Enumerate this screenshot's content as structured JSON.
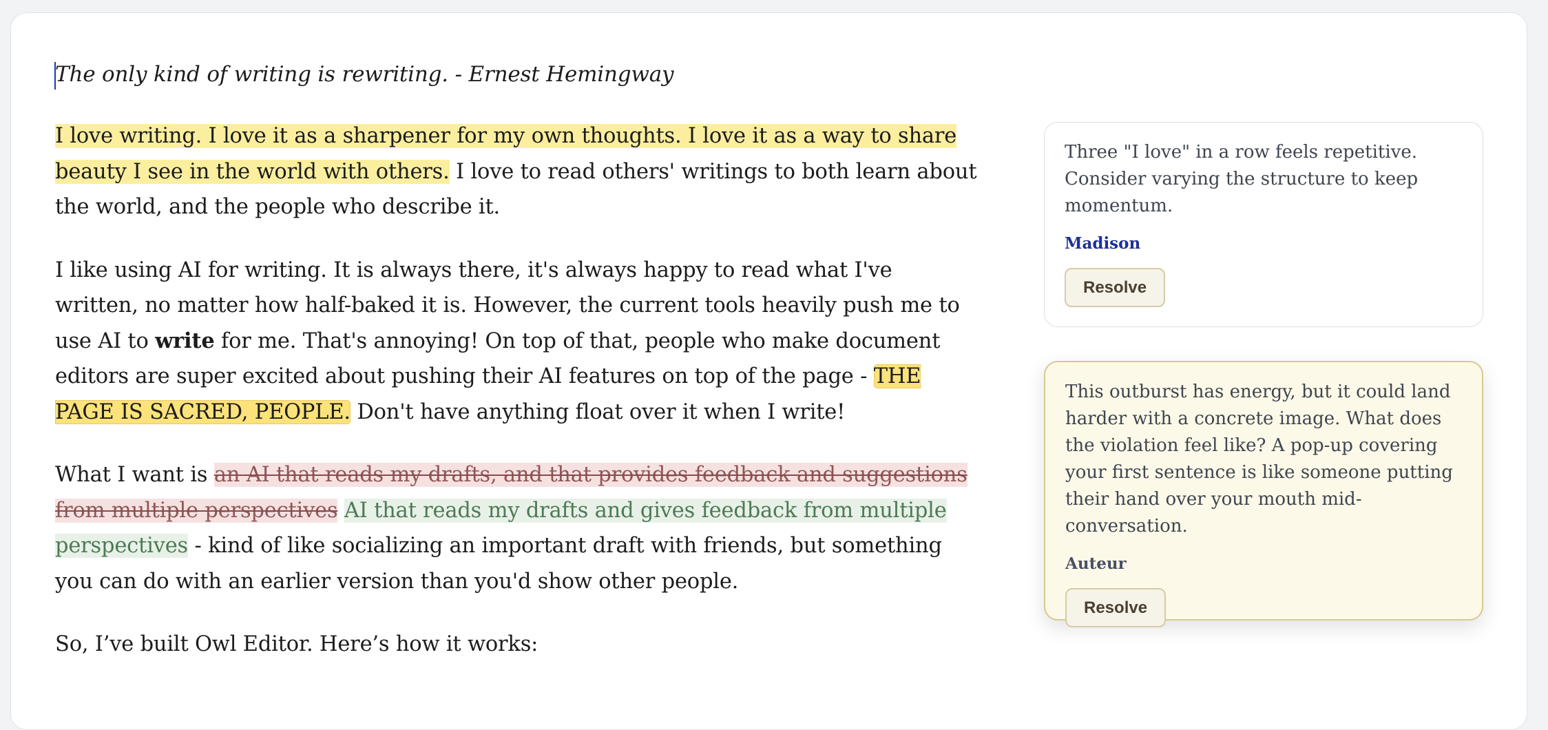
{
  "editor": {
    "quote": "The only kind of writing is rewriting. - Ernest Hemingway",
    "p1": {
      "highlight": "I love writing. I love it as a sharpener for my own thoughts. I love it as a way to share beauty I see in the world with others.",
      "rest": " I love to read others' writings to both learn about the world, and the people who describe it."
    },
    "p2": {
      "a": "I like using AI for writing. It is always there, it's always happy to read what I've written, no matter how half-baked it is. However, the current tools heavily push me to use AI to ",
      "bold": "write",
      "b": " for me. That's annoying! On top of that, people who make document editors are super excited about pushing their AI features on top of the page - ",
      "highlight": "THE PAGE IS SACRED, PEOPLE.",
      "c": " Don't have anything float over it when I write!"
    },
    "p3": {
      "a": "What I want is ",
      "deleted": "an AI that reads my drafts, and that provides feedback and suggestions from multiple perspectives",
      "inserted": "AI that reads my drafts and gives feedback from multiple perspectives",
      "b": " - kind of like socializing an important draft with friends, but something you can do with an earlier version than you'd show other people."
    },
    "p4": "So, I’ve built Owl Editor. Here’s how it works:"
  },
  "comments": [
    {
      "text": "Three \"I love\" in a row feels repetitive. Consider varying the structure to keep momentum.",
      "author": "Madison",
      "resolve_label": "Resolve"
    },
    {
      "text": "This outburst has energy, but it could land harder with a concrete image. What does the violation feel like? A pop-up covering your first sentence is like someone putting their hand over your mouth mid-conversation.",
      "author": "Auteur",
      "resolve_label": "Resolve"
    }
  ],
  "colors": {
    "highlight_soft": "#fbef9f",
    "highlight_strong": "#fbe27b",
    "deleted_bg": "#f6e1e1",
    "inserted_bg": "#e8f1e8",
    "author_madison": "#1e2f99",
    "author_auteur": "#4a5068",
    "caret": "#1a33c8"
  }
}
